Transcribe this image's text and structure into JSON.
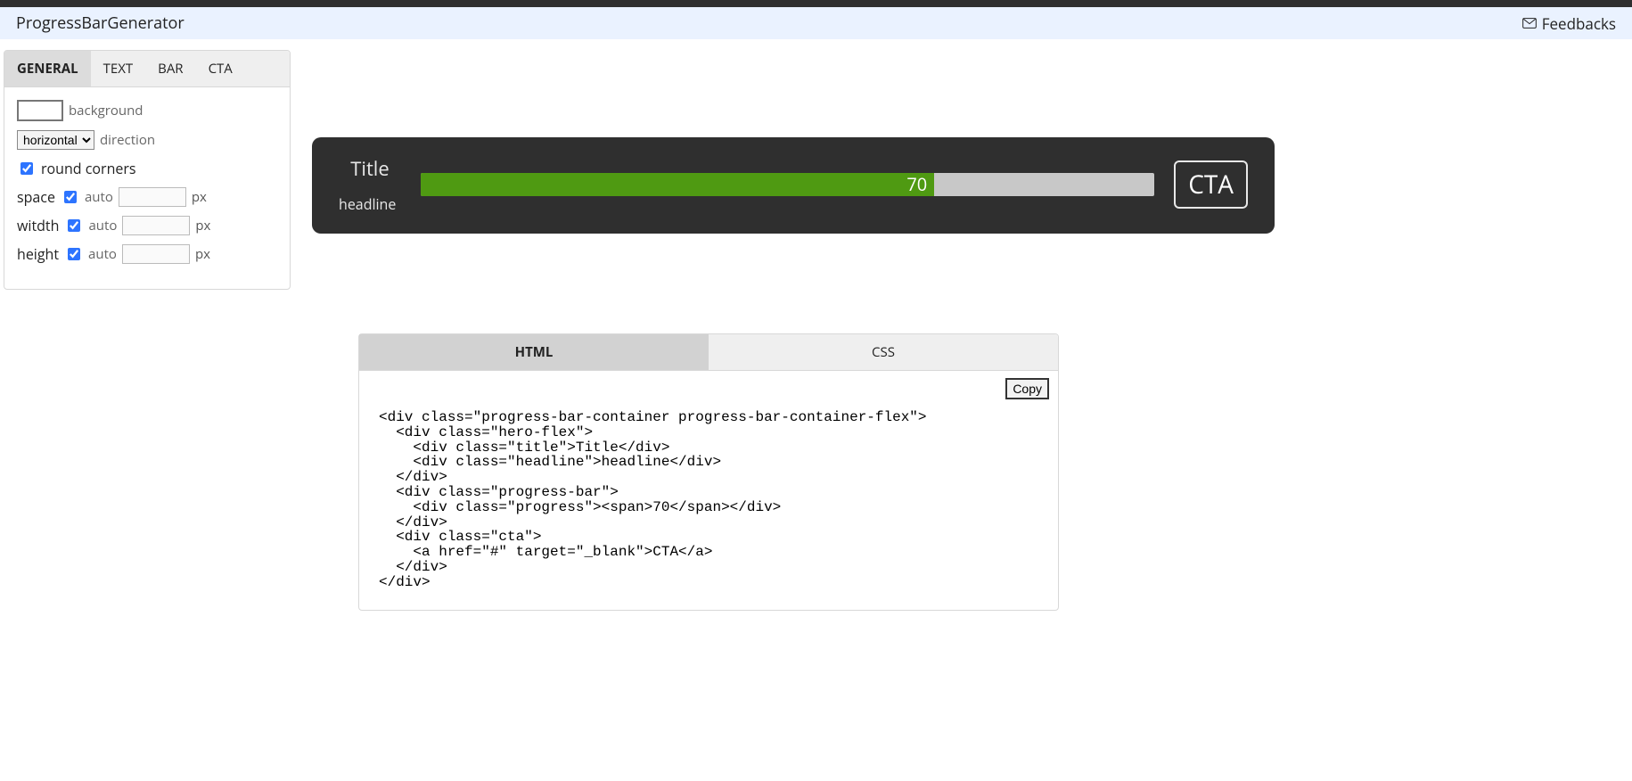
{
  "header": {
    "brand": "ProgressBarGenerator",
    "feedback_label": "Feedbacks"
  },
  "sidebar": {
    "tabs": [
      {
        "label": "GENERAL",
        "active": true
      },
      {
        "label": "TEXT",
        "active": false
      },
      {
        "label": "BAR",
        "active": false
      },
      {
        "label": "CTA",
        "active": false
      }
    ],
    "background_label": "background",
    "background_color": "#2f2f2f",
    "direction_label": "direction",
    "direction_value": "horizontal",
    "round_corners_label": "round corners",
    "round_corners_checked": true,
    "space": {
      "label": "space",
      "auto_label": "auto",
      "auto_checked": true,
      "value": "",
      "unit": "px"
    },
    "width": {
      "label": "witdth",
      "auto_label": "auto",
      "auto_checked": true,
      "value": "",
      "unit": "px"
    },
    "height": {
      "label": "height",
      "auto_label": "auto",
      "auto_checked": true,
      "value": "",
      "unit": "px"
    }
  },
  "preview": {
    "title": "Title",
    "headline": "headline",
    "progress_value": "70",
    "cta_label": "CTA"
  },
  "output": {
    "tabs": [
      {
        "label": "HTML",
        "active": true
      },
      {
        "label": "CSS",
        "active": false
      }
    ],
    "copy_label": "Copy",
    "code": "<div class=\"progress-bar-container progress-bar-container-flex\">\n  <div class=\"hero-flex\">\n    <div class=\"title\">Title</div>\n    <div class=\"headline\">headline</div>\n  </div>\n  <div class=\"progress-bar\">\n    <div class=\"progress\"><span>70</span></div>\n  </div>\n  <div class=\"cta\">\n    <a href=\"#\" target=\"_blank\">CTA</a>\n  </div>\n</div>"
  }
}
